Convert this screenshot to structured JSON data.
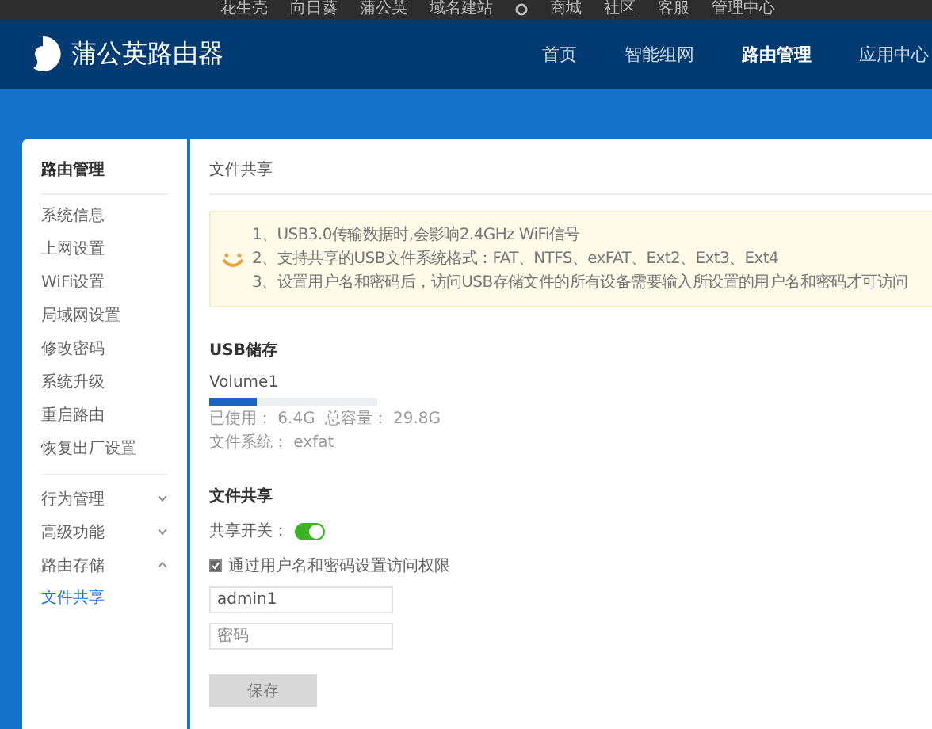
{
  "top_links": [
    "花生壳",
    "向日葵",
    "蒲公英",
    "域名建站",
    "商城",
    "社区",
    "客服",
    "管理中心"
  ],
  "header": {
    "brand": "蒲公英路由器",
    "nav": [
      {
        "label": "首页",
        "selected": false
      },
      {
        "label": "智能组网",
        "selected": false
      },
      {
        "label": "路由管理",
        "selected": true
      },
      {
        "label": "应用中心",
        "selected": false
      }
    ]
  },
  "sidebar": {
    "title": "路由管理",
    "items": [
      {
        "label": "系统信息",
        "selected": false
      },
      {
        "label": "上网设置",
        "selected": false
      },
      {
        "label": "WiFi设置",
        "selected": false
      },
      {
        "label": "局域网设置",
        "selected": false
      },
      {
        "label": "修改密码",
        "selected": false
      },
      {
        "label": "系统升级",
        "selected": false
      },
      {
        "label": "重启路由",
        "selected": false
      },
      {
        "label": "恢复出厂设置",
        "selected": false
      }
    ],
    "groups": [
      {
        "label": "行为管理",
        "expanded": false
      },
      {
        "label": "高级功能",
        "expanded": false
      },
      {
        "label": "路由存储",
        "expanded": true,
        "children": [
          {
            "label": "文件共享",
            "selected": true
          }
        ]
      }
    ]
  },
  "page_title": "文件共享",
  "notice": [
    "1、USB3.0传输数据时,会影响2.4GHz WiFi信号",
    "2、支持共享的USB文件系统格式：FAT、NTFS、exFAT、Ext2、Ext3、Ext4",
    "3、设置用户名和密码后，访问USB存储文件的所有设备需要输入所设置的用户名和密码才可访问"
  ],
  "usb": {
    "heading": "USB储存",
    "volume": "Volume1",
    "level": 0.28,
    "used": "已使用： 6.4G",
    "total": "总容量： 29.8G",
    "filesystem": "文件系统： exfat"
  },
  "share": {
    "heading": "文件共享",
    "switch_label": "共享开关：",
    "on": true,
    "auth_label": "通过用户名和密码设置访问权限",
    "auth_checked": true,
    "username": "admin1",
    "password_placeholder": "密码",
    "save": {
      "label": "保存",
      "disabled": true
    }
  }
}
